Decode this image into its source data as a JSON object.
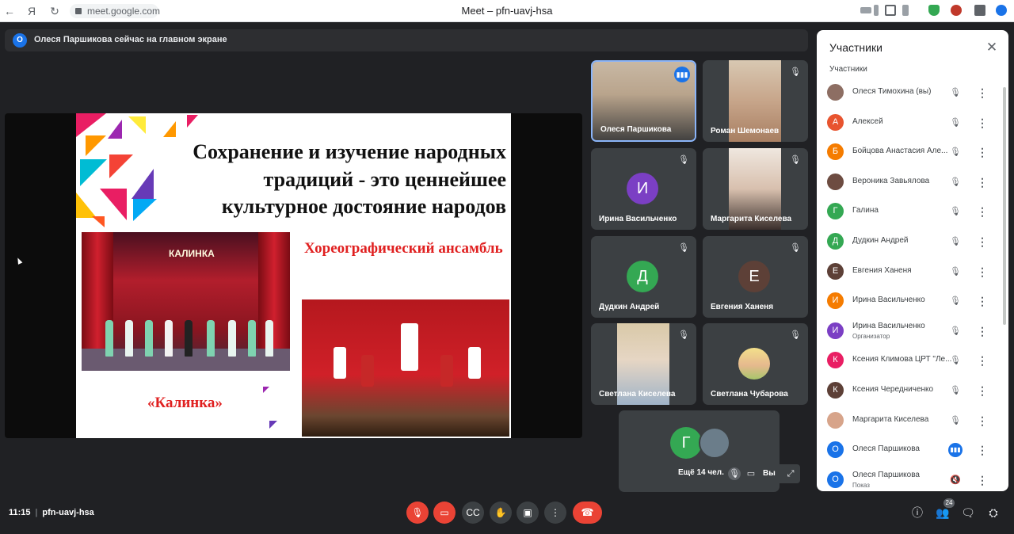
{
  "browser": {
    "url": "meet.google.com",
    "window_title": "Meet – pfn-uavj-hsa"
  },
  "banner": {
    "badge": "О",
    "text": "Олеся Паршикова сейчас на главном экране"
  },
  "slide": {
    "title_lines": [
      "Сохранение и изучение народных",
      "традиций - это ценнейшее",
      "культурное достояние народов"
    ],
    "photo_sign": "КАЛИНКА",
    "subtitle": "Хореографический ансамбль",
    "caption": "«Калинка»"
  },
  "tiles": [
    {
      "name": "Олеся Паршикова",
      "active": true
    },
    {
      "name": "Роман Шемонаев"
    },
    {
      "name": "Ирина Васильченко",
      "initial": "И",
      "color": "#7b3fc4"
    },
    {
      "name": "Маргарита Киселева"
    },
    {
      "name": "Дудкин Андрей",
      "initial": "Д",
      "color": "#34a853"
    },
    {
      "name": "Евгения Ханеня",
      "initial": "Е",
      "color": "#5d4037"
    },
    {
      "name": "Светлана Киселева"
    },
    {
      "name": "Светлана Чубарова"
    }
  ],
  "more_tile": {
    "initial": "Г",
    "label": "Ещё 14 чел."
  },
  "self_chip": {
    "label": "Вы"
  },
  "panel": {
    "title": "Участники",
    "subtitle": "Участники",
    "participants": [
      {
        "name": "Олеся Тимохина (вы)",
        "avatar": "photo",
        "color": "#8d6e63"
      },
      {
        "name": "Алексей",
        "initial": "А",
        "color": "#e8542f"
      },
      {
        "name": "Бойцова Анастасия Але...",
        "initial": "Б",
        "color": "#f57c00"
      },
      {
        "name": "Вероника Завьялова",
        "avatar": "photo",
        "color": "#6d4c41"
      },
      {
        "name": "Галина",
        "initial": "Г",
        "color": "#34a853"
      },
      {
        "name": "Дудкин Андрей",
        "initial": "Д",
        "color": "#34a853"
      },
      {
        "name": "Евгения Ханеня",
        "initial": "Е",
        "color": "#5d4037"
      },
      {
        "name": "Ирина Васильченко",
        "initial": "И",
        "color": "#f57c00"
      },
      {
        "name": "Ирина Васильченко",
        "role": "Организатор",
        "initial": "И",
        "color": "#7b3fc4"
      },
      {
        "name": "Ксения Климова ЦРТ \"Ле...",
        "initial": "К",
        "color": "#e91e63"
      },
      {
        "name": "Ксения Чередниченко",
        "initial": "К",
        "color": "#5d4037"
      },
      {
        "name": "Маргарита Киселева",
        "avatar": "photo",
        "color": "#d7a48a"
      },
      {
        "name": "Олеся Паршикова",
        "initial": "О",
        "color": "#1a73e8",
        "speaking": true
      },
      {
        "name": "Олеся Паршикова",
        "role": "Показ",
        "initial": "О",
        "color": "#1a73e8",
        "presenting": true
      }
    ]
  },
  "bottom": {
    "time": "11:15",
    "meeting_code": "pfn-uavj-hsa",
    "people_count": "24"
  }
}
